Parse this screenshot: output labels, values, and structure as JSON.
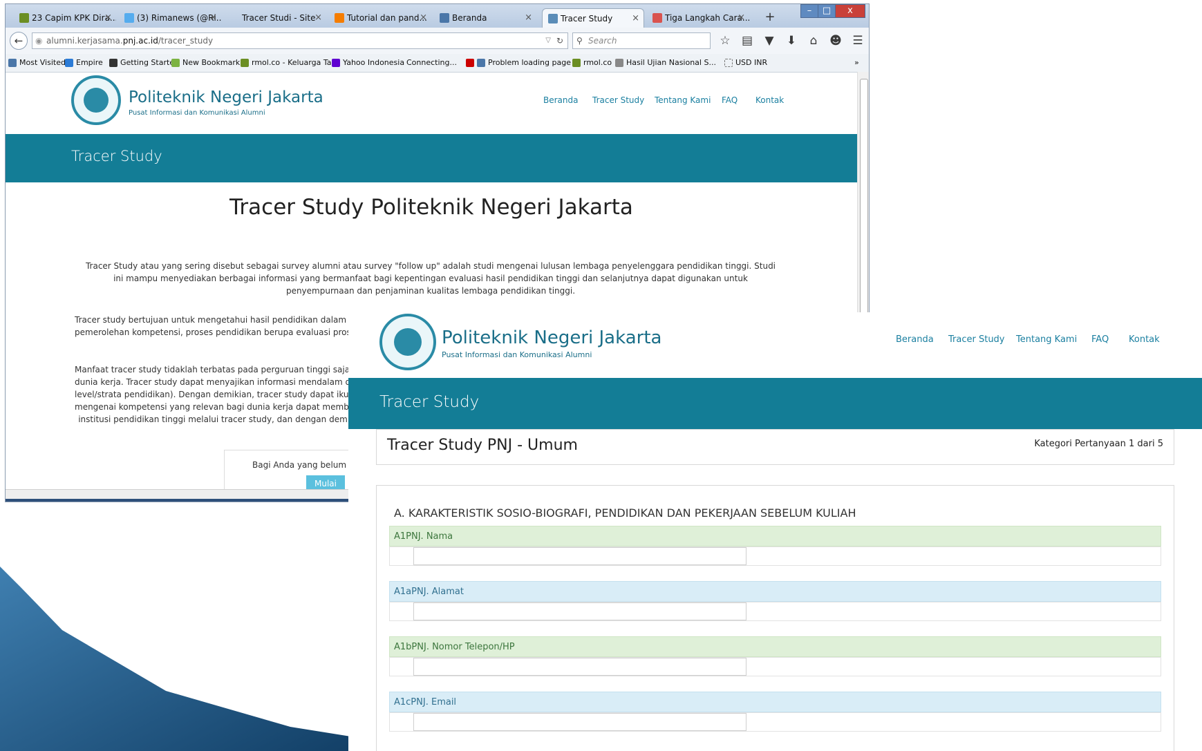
{
  "back_window": {
    "tabs": [
      {
        "label": "23 Capim KPK Dira...",
        "color": "#6b8e23"
      },
      {
        "label": "(3) Rimanews (@Ri...",
        "color": "#55acee"
      },
      {
        "label": "Tracer Studi - Site",
        "color": ""
      },
      {
        "label": "Tutorial dan pand...",
        "color": "#f57d00"
      },
      {
        "label": "Beranda",
        "color": "#4a76a8"
      },
      {
        "label": "Tracer Study",
        "color": "#5b8db8",
        "active": true
      },
      {
        "label": "Tiga Langkah Cara...",
        "color": "#d9534f"
      }
    ],
    "new_tab": "+",
    "window_controls": [
      "–",
      "□",
      "x"
    ],
    "url": {
      "prefix": "alumni.kerjasama.",
      "domain": "pnj.ac.id",
      "path": "/tracer_study"
    },
    "search_placeholder": "Search",
    "bookmarks": [
      {
        "label": "Most Visited",
        "color": "#4a76a8"
      },
      {
        "label": "Empire",
        "color": "#2b7bd6"
      },
      {
        "label": "Getting Started",
        "color": "#333333"
      },
      {
        "label": "New Bookmark",
        "color": "#7cb342"
      },
      {
        "label": "rmol.co - Keluarga Ta...",
        "color": "#6b8e23"
      },
      {
        "label": "Yahoo Indonesia",
        "color": "#5f01d1"
      },
      {
        "label": "Connecting...",
        "color": ""
      },
      {
        "label": "",
        "color": "#cc0000"
      },
      {
        "label": "Problem loading page",
        "color": "#4a76a8"
      },
      {
        "label": "rmol.co",
        "color": "#6b8e23"
      },
      {
        "label": "Hasil Ujian Nasional S...",
        "color": "#888888"
      },
      {
        "label": "USD INR",
        "color": ""
      }
    ],
    "bookmarks_more": "»",
    "site": {
      "title": "Politeknik Negeri Jakarta",
      "subtitle": "Pusat Informasi dan Komunikasi Alumni",
      "nav": [
        "Beranda",
        "Tracer Study",
        "Tentang Kami",
        "FAQ",
        "Kontak"
      ],
      "banner": "Tracer Study",
      "heading": "Tracer Study Politeknik Negeri Jakarta",
      "paragraph1": "Tracer Study atau yang sering disebut sebagai survey alumni atau survey \"follow up\" adalah studi mengenai lulusan lembaga penyelenggara pendidikan tinggi. Studi ini mampu menyediakan berbagai informasi yang bermanfaat bagi kepentingan evaluasi hasil pendidikan tinggi dan selanjutnya dapat digunakan untuk penyempurnaan dan penjaminan kualitas lembaga pendidikan tinggi.",
      "paragraph2_lines": [
        "Tracer study bertujuan untuk mengetahui hasil pendidikan dalam bentuk",
        "pemerolehan kompetensi, proses pendidikan berupa evaluasi proses pemb"
      ],
      "paragraph3_lines": [
        "Manfaat tracer study tidaklah terbatas pada perguruan tinggi saja, tetapi",
        "dunia kerja. Tracer study dapat menyajikan informasi mendalam dan ri",
        "level/strata pendidikan). Dengan demikian, tracer study dapat ikut me",
        "mengenai kompetensi yang relevan bagi dunia kerja dapat membantu u",
        "institusi pendidikan tinggi melalui tracer study, dan dengan dem"
      ],
      "cta_text": "Bagi Anda yang belum per",
      "cta_button": "Mulai"
    }
  },
  "front": {
    "site": {
      "title": "Politeknik Negeri Jakarta",
      "subtitle": "Pusat Informasi dan Komunikasi Alumni",
      "nav": [
        "Beranda",
        "Tracer Study",
        "Tentang Kami",
        "FAQ",
        "Kontak"
      ],
      "banner": "Tracer Study"
    },
    "survey_title": "Tracer Study PNJ - Umum",
    "category_progress": "Kategori Pertanyaan 1 dari 5",
    "section_title": "A. KARAKTERISTIK SOSIO-BIOGRAFI, PENDIDIKAN DAN PEKERJAAN SEBELUM KULIAH",
    "questions": [
      {
        "label": "A1PNJ. Nama",
        "style": "green",
        "value": ""
      },
      {
        "label": "A1aPNJ. Alamat",
        "style": "blue",
        "value": ""
      },
      {
        "label": "A1bPNJ. Nomor Telepon/HP",
        "style": "green",
        "value": ""
      },
      {
        "label": "A1cPNJ. Email",
        "style": "blue",
        "value": ""
      }
    ]
  },
  "colors": {
    "brand": "#137d96",
    "link": "#1a7fa0",
    "wedge": "#1f5f8b"
  }
}
